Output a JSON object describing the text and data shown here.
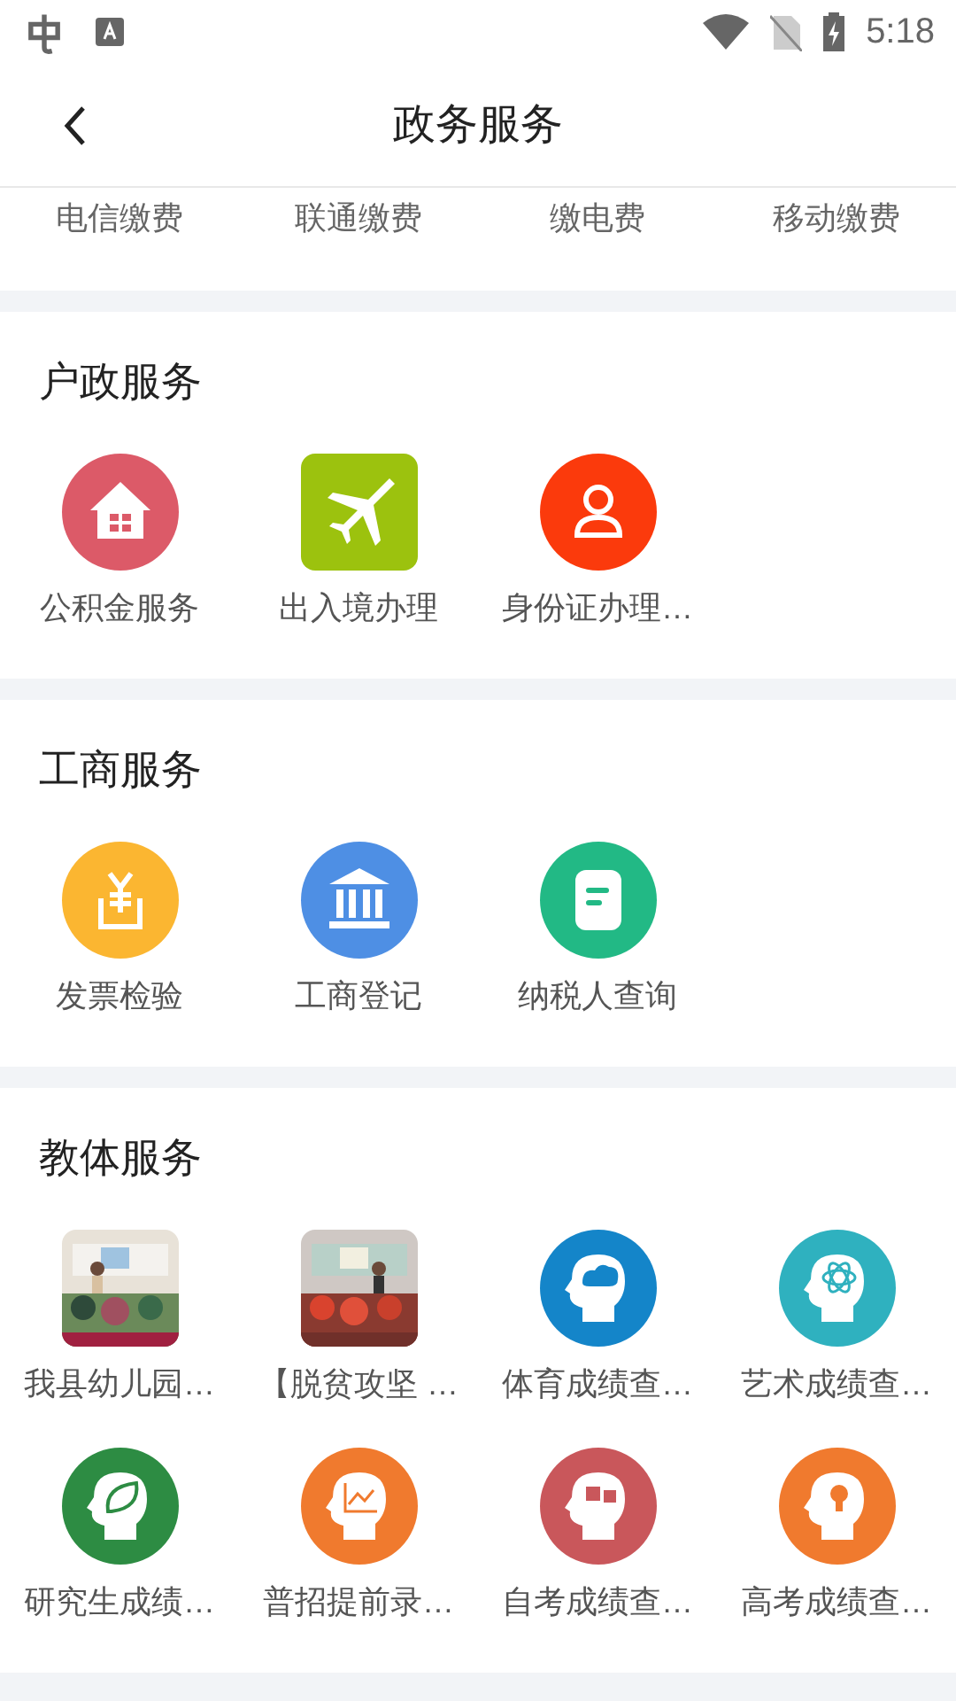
{
  "status_bar": {
    "time": "5:18"
  },
  "header": {
    "title": "政务服务"
  },
  "top_strip": [
    "电信缴费",
    "联通缴费",
    "缴电费",
    "移动缴费"
  ],
  "sections": [
    {
      "title": "户政服务",
      "items": [
        {
          "label": "公积金服务",
          "kind": "badge",
          "color": "#dc5a68"
        },
        {
          "label": "出入境办理",
          "kind": "tile",
          "color": "#9cc20e"
        },
        {
          "label": "身份证办理…",
          "kind": "badge",
          "color": "#fb3a0c"
        }
      ]
    },
    {
      "title": "工商服务",
      "items": [
        {
          "label": "发票检验",
          "kind": "badge",
          "color": "#fbb631"
        },
        {
          "label": "工商登记",
          "kind": "badge",
          "color": "#4e8fe4"
        },
        {
          "label": "纳税人查询",
          "kind": "badge",
          "color": "#22b985"
        }
      ]
    },
    {
      "title": "教体服务",
      "items": [
        {
          "label": "我县幼儿园…",
          "kind": "picture"
        },
        {
          "label": "【脱贫攻坚 …",
          "kind": "picture"
        },
        {
          "label": "体育成绩查…",
          "kind": "badge",
          "color": "#1485c9"
        },
        {
          "label": "艺术成绩查…",
          "kind": "badge",
          "color": "#2fb1bf"
        },
        {
          "label": "研究生成绩…",
          "kind": "badge",
          "color": "#2d8c43"
        },
        {
          "label": "普招提前录…",
          "kind": "badge",
          "color": "#f07a2e"
        },
        {
          "label": "自考成绩查…",
          "kind": "badge",
          "color": "#c9575b"
        },
        {
          "label": "高考成绩查…",
          "kind": "badge",
          "color": "#f07a2e"
        }
      ]
    }
  ]
}
